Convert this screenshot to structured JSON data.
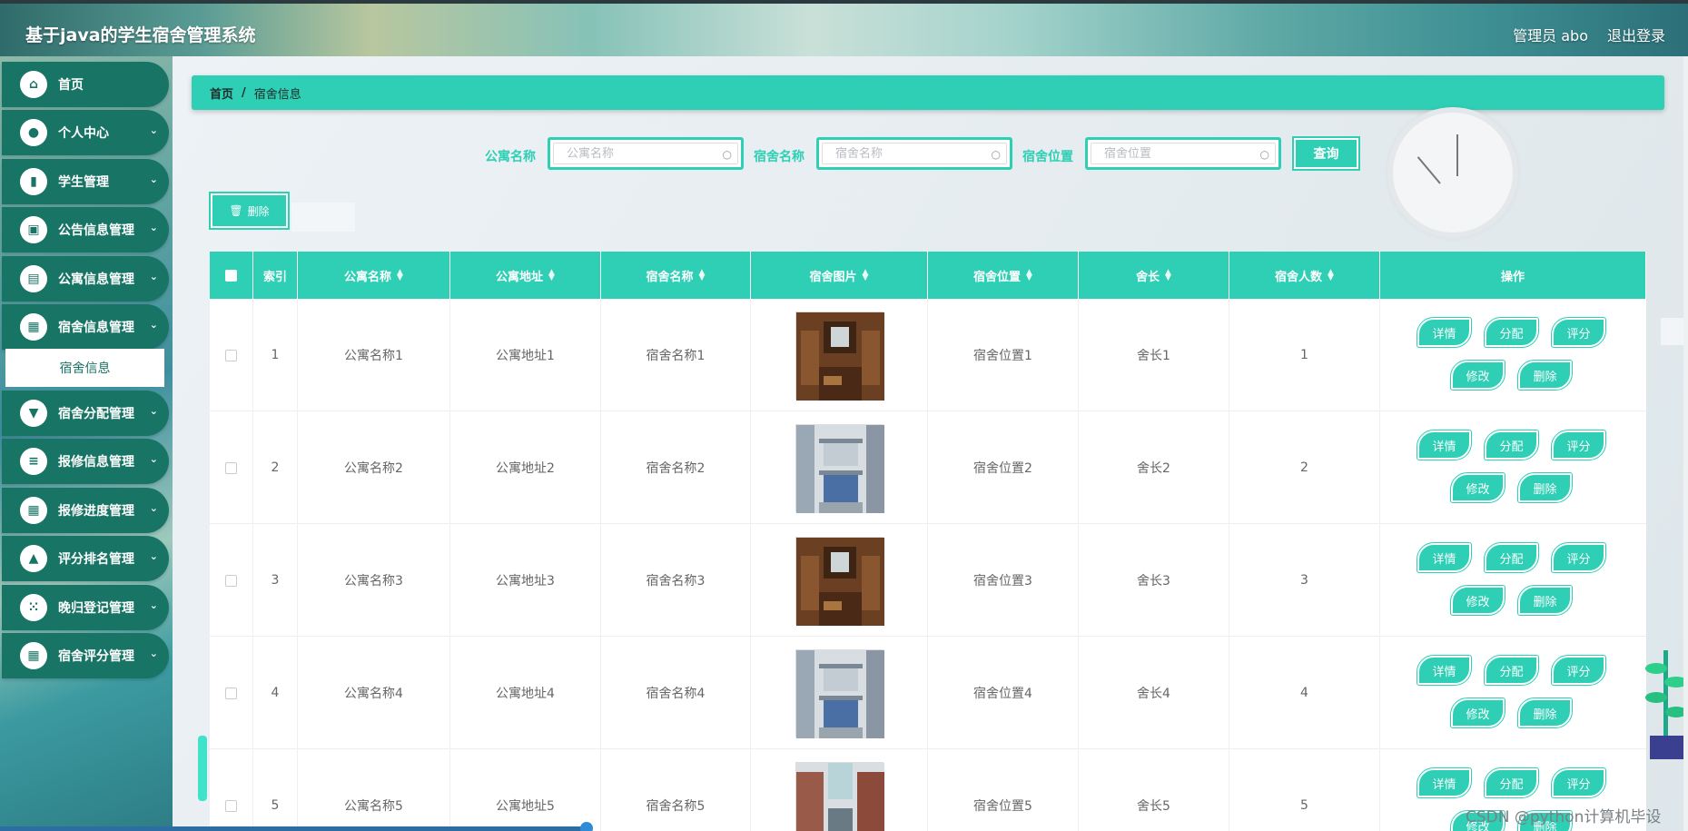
{
  "header": {
    "title": "基于java的学生宿舍管理系统",
    "user": "管理员 abo",
    "logout": "退出登录"
  },
  "sidebar": {
    "items": [
      {
        "label": "首页",
        "icon": "home-icon",
        "glyph": "⌂"
      },
      {
        "label": "个人中心",
        "icon": "user-icon",
        "glyph": "●"
      },
      {
        "label": "学生管理",
        "icon": "bar-chart-icon",
        "glyph": "▮"
      },
      {
        "label": "公告信息管理",
        "icon": "briefcase-icon",
        "glyph": "▣"
      },
      {
        "label": "公寓信息管理",
        "icon": "building-icon",
        "glyph": "▤"
      },
      {
        "label": "宿舍信息管理",
        "icon": "grid-icon",
        "glyph": "▦"
      },
      {
        "label": "宿舍分配管理",
        "icon": "sign-icon",
        "glyph": "▼"
      },
      {
        "label": "报修信息管理",
        "icon": "sliders-icon",
        "glyph": "≡"
      },
      {
        "label": "报修进度管理",
        "icon": "grid-icon",
        "glyph": "▦"
      },
      {
        "label": "评分排名管理",
        "icon": "thumbs-up-icon",
        "glyph": "▲"
      },
      {
        "label": "晚归登记管理",
        "icon": "apps-icon",
        "glyph": "⁙"
      },
      {
        "label": "宿舍评分管理",
        "icon": "grid-icon",
        "glyph": "▦"
      }
    ],
    "submenu": "宿舍信息"
  },
  "breadcrumb": {
    "home": "首页",
    "sep": "/",
    "current": "宿舍信息"
  },
  "search": {
    "apartment_label": "公寓名称",
    "apartment_placeholder": "公寓名称",
    "dorm_label": "宿舍名称",
    "dorm_placeholder": "宿舍名称",
    "location_label": "宿舍位置",
    "location_placeholder": "宿舍位置",
    "query": "查询"
  },
  "toolbar": {
    "delete": "删除"
  },
  "table": {
    "columns": [
      "索引",
      "公寓名称",
      "公寓地址",
      "宿舍名称",
      "宿舍图片",
      "宿舍位置",
      "舍长",
      "宿舍人数",
      "操作"
    ],
    "rows": [
      {
        "index": "1",
        "apartment": "公寓名称1",
        "address": "公寓地址1",
        "dorm": "宿舍名称1",
        "location": "宿舍位置1",
        "leader": "舍长1",
        "count": "1",
        "photo": "wood"
      },
      {
        "index": "2",
        "apartment": "公寓名称2",
        "address": "公寓地址2",
        "dorm": "宿舍名称2",
        "location": "宿舍位置2",
        "leader": "舍长2",
        "count": "2",
        "photo": "bunk"
      },
      {
        "index": "3",
        "apartment": "公寓名称3",
        "address": "公寓地址3",
        "dorm": "宿舍名称3",
        "location": "宿舍位置3",
        "leader": "舍长3",
        "count": "3",
        "photo": "wood"
      },
      {
        "index": "4",
        "apartment": "公寓名称4",
        "address": "公寓地址4",
        "dorm": "宿舍名称4",
        "location": "宿舍位置4",
        "leader": "舍长4",
        "count": "4",
        "photo": "bunk"
      },
      {
        "index": "5",
        "apartment": "公寓名称5",
        "address": "公寓地址5",
        "dorm": "宿舍名称5",
        "location": "宿舍位置5",
        "leader": "舍长5",
        "count": "5",
        "photo": "bunk2"
      }
    ],
    "actions": [
      "详情",
      "分配",
      "评分",
      "修改",
      "删除"
    ]
  },
  "watermark": "CSDN @python计算机毕设",
  "colors": {
    "accent": "#2ecfb5",
    "sidebar_item": "#187566"
  }
}
